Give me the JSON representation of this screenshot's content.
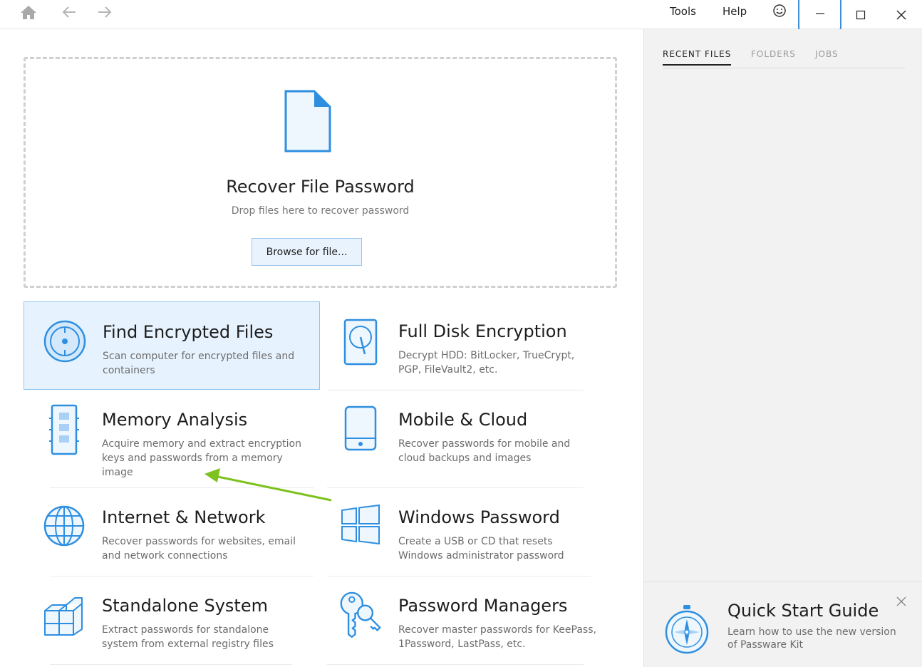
{
  "menu": {
    "tools": "Tools",
    "help": "Help"
  },
  "dropzone": {
    "title": "Recover File Password",
    "subtitle": "Drop files here to recover password",
    "browse_label": "Browse for file..."
  },
  "tiles": [
    {
      "title": "Find Encrypted Files",
      "desc": "Scan computer for encrypted files and containers",
      "icon": "disc-scan-icon"
    },
    {
      "title": "Full Disk Encryption",
      "desc": "Decrypt HDD: BitLocker, TrueCrypt, PGP, FileVault2, etc.",
      "icon": "hard-disk-icon"
    },
    {
      "title": "Memory Analysis",
      "desc": "Acquire memory and extract encryption keys and passwords from a memory image",
      "icon": "memory-chip-icon"
    },
    {
      "title": "Mobile & Cloud",
      "desc": "Recover passwords for mobile and cloud backups and images",
      "icon": "mobile-phone-icon"
    },
    {
      "title": "Internet & Network",
      "desc": "Recover passwords for websites, email and network connections",
      "icon": "globe-icon"
    },
    {
      "title": "Windows Password",
      "desc": "Create a USB or CD that resets Windows administrator password",
      "icon": "windows-logo-icon"
    },
    {
      "title": "Standalone System",
      "desc": "Extract passwords for standalone system from external registry files",
      "icon": "cubes-icon"
    },
    {
      "title": "Password Managers",
      "desc": "Recover master passwords for KeePass, 1Password, LastPass, etc.",
      "icon": "keys-icon"
    }
  ],
  "side": {
    "tabs": [
      "RECENT FILES",
      "FOLDERS",
      "JOBS"
    ],
    "active_tab": "RECENT FILES",
    "quickstart": {
      "title": "Quick Start Guide",
      "desc": "Learn how to use the new version of Passware Kit"
    }
  },
  "colors": {
    "accent": "#2e8fe0",
    "selected_bg": "#e6f3fe",
    "annotation_arrow": "#7dc21e"
  }
}
